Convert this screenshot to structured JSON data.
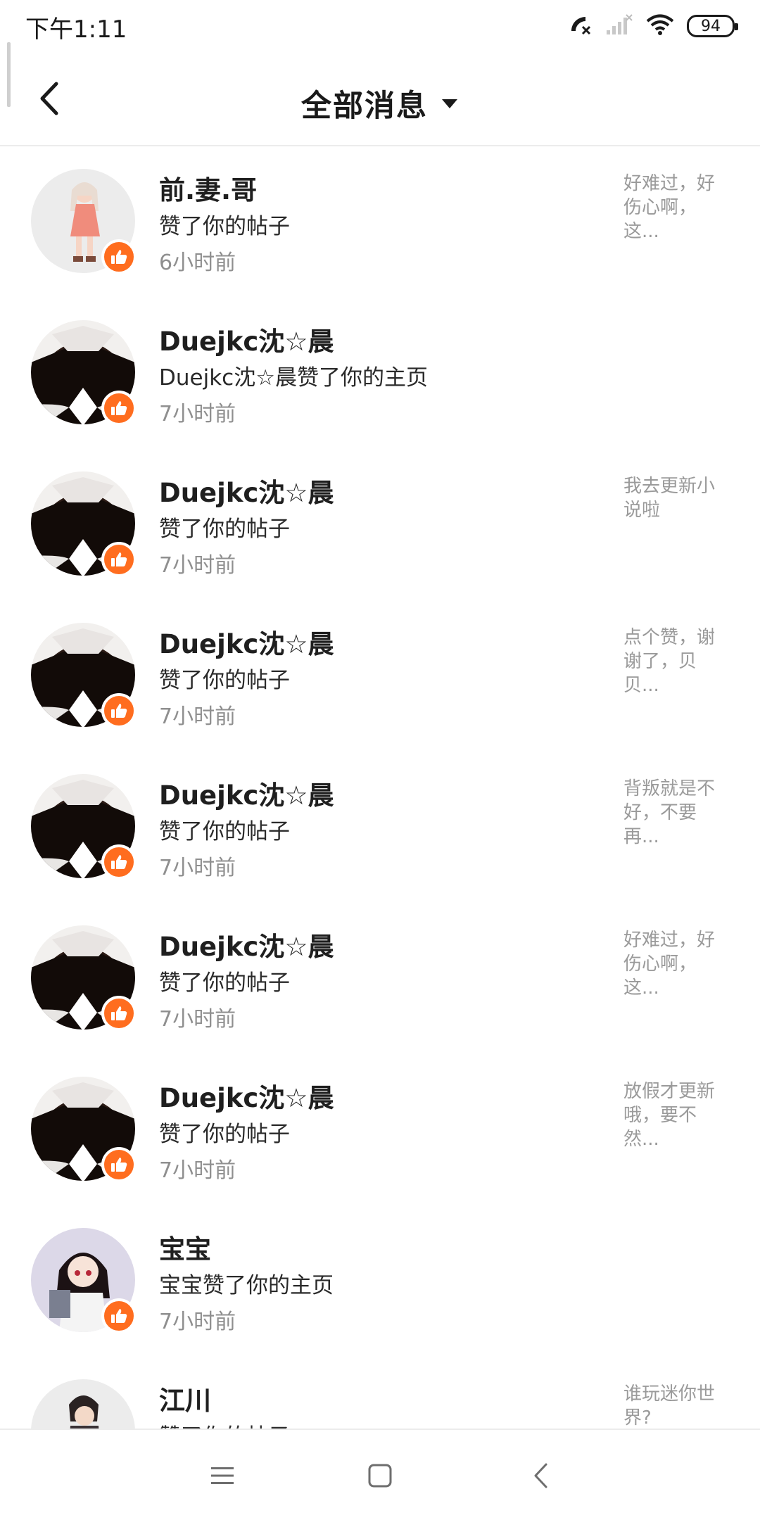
{
  "status_bar": {
    "time": "下午1:11",
    "battery": "94",
    "icons": [
      "missed-call-icon",
      "signal-icon",
      "wifi-icon",
      "battery-icon"
    ]
  },
  "header": {
    "title": "全部消息",
    "icons": [
      "back-arrow-icon",
      "dropdown-caret-icon"
    ]
  },
  "colors": {
    "accent": "#ff6d1f",
    "text_primary": "#1f1f1f",
    "text_secondary": "#8f8f8f",
    "snippet": "#9a9a9a",
    "divider": "#ececec"
  },
  "notifications": [
    {
      "name": "前.妻.哥",
      "action": "赞了你的帖子",
      "time": "6小时前",
      "snippet": "好难过，好伤心啊，这...",
      "avatar": "anime-girl-pink"
    },
    {
      "name": "Duejkc沈☆晨",
      "action": "Duejkc沈☆晨赞了你的主页",
      "time": "7小时前",
      "snippet": "",
      "avatar": "dark-diamond"
    },
    {
      "name": "Duejkc沈☆晨",
      "action": "赞了你的帖子",
      "time": "7小时前",
      "snippet": "我去更新小说啦",
      "avatar": "dark-diamond"
    },
    {
      "name": "Duejkc沈☆晨",
      "action": "赞了你的帖子",
      "time": "7小时前",
      "snippet": "点个赞，谢谢了，贝贝...",
      "avatar": "dark-diamond"
    },
    {
      "name": "Duejkc沈☆晨",
      "action": "赞了你的帖子",
      "time": "7小时前",
      "snippet": "背叛就是不好，不要再...",
      "avatar": "dark-diamond"
    },
    {
      "name": "Duejkc沈☆晨",
      "action": "赞了你的帖子",
      "time": "7小时前",
      "snippet": "好难过，好伤心啊，这...",
      "avatar": "dark-diamond"
    },
    {
      "name": "Duejkc沈☆晨",
      "action": "赞了你的帖子",
      "time": "7小时前",
      "snippet": "放假才更新哦，要不然...",
      "avatar": "dark-diamond"
    },
    {
      "name": "宝宝",
      "action": "宝宝赞了你的主页",
      "time": "7小时前",
      "snippet": "",
      "avatar": "anime-girl-dark"
    },
    {
      "name": "江川",
      "action": "赞了你的帖子",
      "time": "",
      "snippet": "谁玩迷你世界?",
      "avatar": "anime-boy"
    }
  ],
  "nav_bar": {
    "icons": [
      "menu-icon",
      "home-square-icon",
      "back-chevron-icon"
    ]
  }
}
